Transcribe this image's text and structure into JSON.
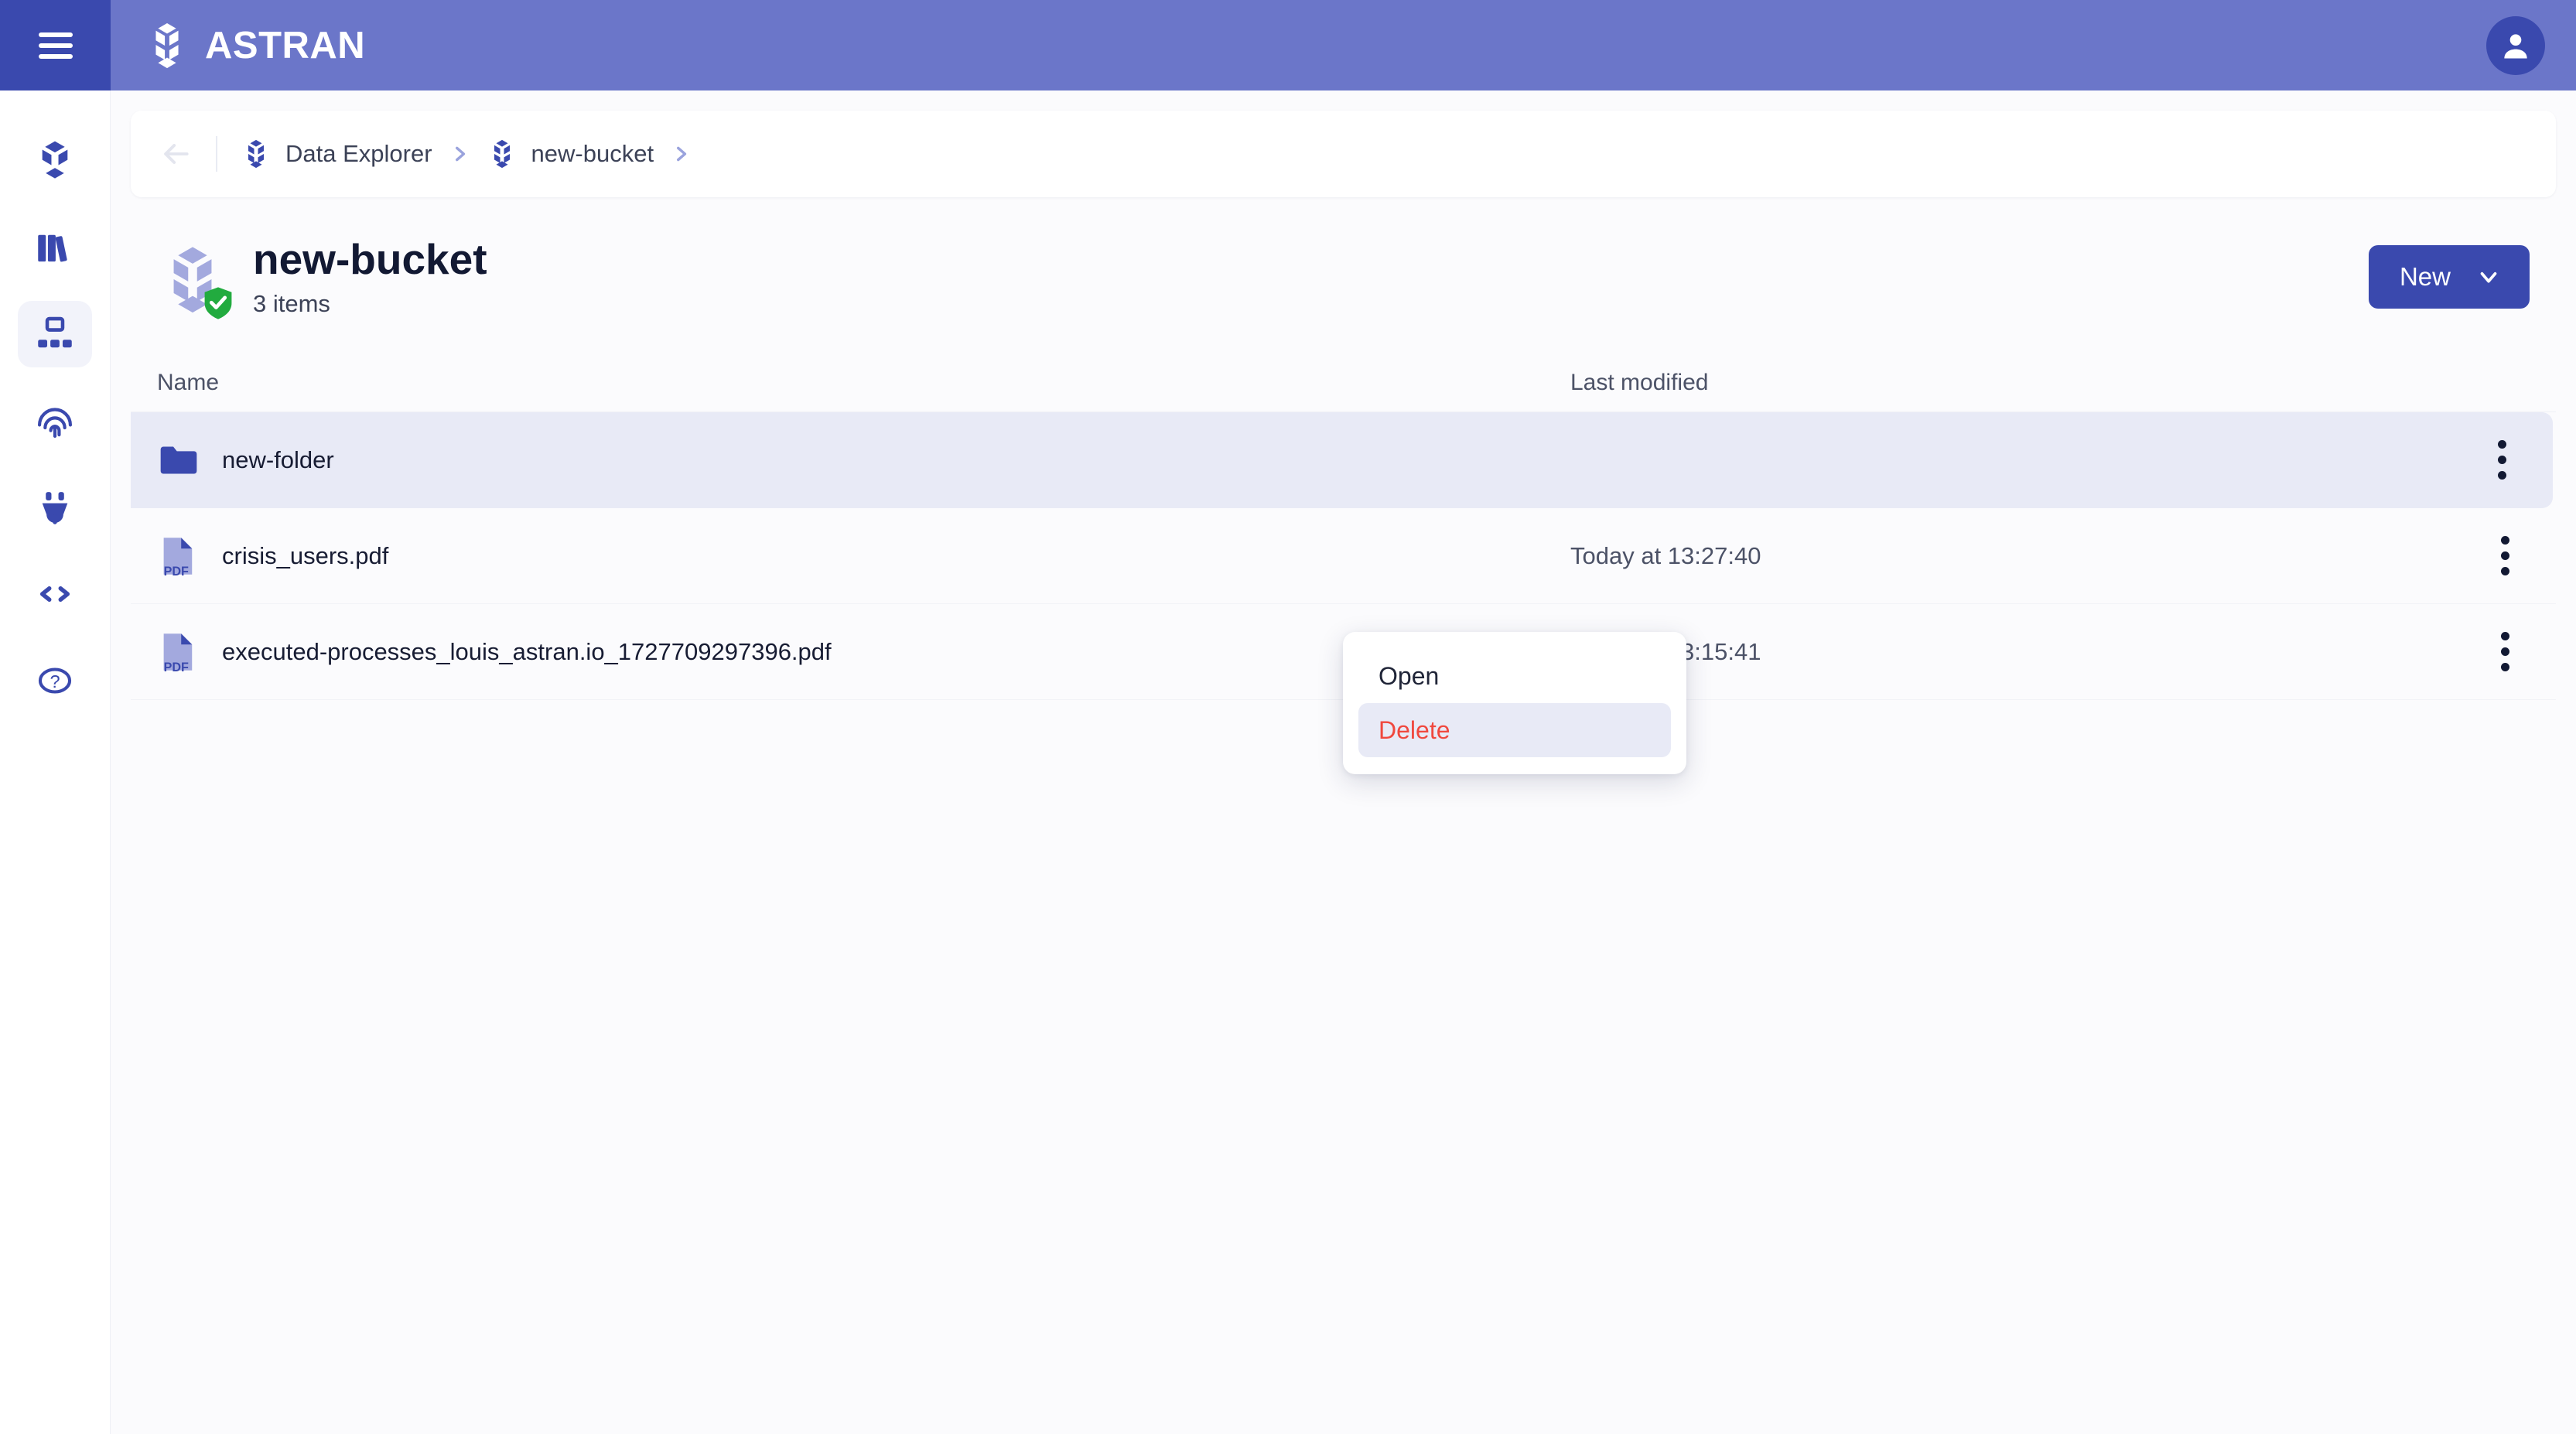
{
  "header": {
    "menu_icon": "hamburger-icon",
    "brand_icon": "astran-hexagon-logo",
    "brand_name": "ASTRAN",
    "avatar_icon": "user-avatar-icon",
    "bar_color": "#6b76c9",
    "menu_zone_color": "#3a49ae"
  },
  "sidebar": {
    "items": [
      {
        "icon": "hexagon-cube-icon",
        "name": "sidebar-item-overview",
        "active": false
      },
      {
        "icon": "library-books-icon",
        "name": "sidebar-item-library",
        "active": false
      },
      {
        "icon": "data-explorer-sitemap-icon",
        "name": "sidebar-item-data-explorer",
        "active": true
      },
      {
        "icon": "fingerprint-icon",
        "name": "sidebar-item-identity",
        "active": false
      },
      {
        "icon": "plug-icon",
        "name": "sidebar-item-integrations",
        "active": false
      },
      {
        "icon": "code-brackets-icon",
        "name": "sidebar-item-developers",
        "active": false
      },
      {
        "icon": "help-circle-icon",
        "name": "sidebar-item-help",
        "active": false
      }
    ],
    "active_bg": "#f2f3fa",
    "icon_color": "#3a49ae"
  },
  "breadcrumb": {
    "back_icon": "back-arrow-icon",
    "items": [
      {
        "icon": "hexagon-icon",
        "label": "Data Explorer"
      },
      {
        "icon": "hexagon-icon",
        "label": "new-bucket"
      }
    ],
    "separator_icon": "chevron-right-icon"
  },
  "page_header": {
    "bucket_icon": "hexagon-bucket-icon",
    "badge_icon": "shield-check-icon",
    "badge_color": "#22ab3f",
    "title": "new-bucket",
    "subtitle": "3 items",
    "new_button": {
      "label": "New",
      "icon": "chevron-down-icon",
      "color": "#3a49ae"
    }
  },
  "table": {
    "columns": [
      "Name",
      "Last modified"
    ],
    "rows": [
      {
        "icon": "folder-icon",
        "name": "new-folder",
        "modified": "",
        "selected": true,
        "kebab": "more-vertical-icon"
      },
      {
        "icon": "pdf-file-icon",
        "name": "crisis_users.pdf",
        "modified": "Today at 13:27:40",
        "selected": false,
        "kebab": "more-vertical-icon"
      },
      {
        "icon": "pdf-file-icon",
        "name": "executed-processes_louis_astran.io_1727709297396.pdf",
        "modified": "Today at 13:15:41",
        "selected": false,
        "kebab": "more-vertical-icon"
      }
    ]
  },
  "context_menu": {
    "items": [
      {
        "label": "Open",
        "danger": false,
        "hovered": false
      },
      {
        "label": "Delete",
        "danger": true,
        "hovered": true
      }
    ],
    "danger_color": "#f0483e",
    "hover_bg": "#e8eaf6"
  }
}
